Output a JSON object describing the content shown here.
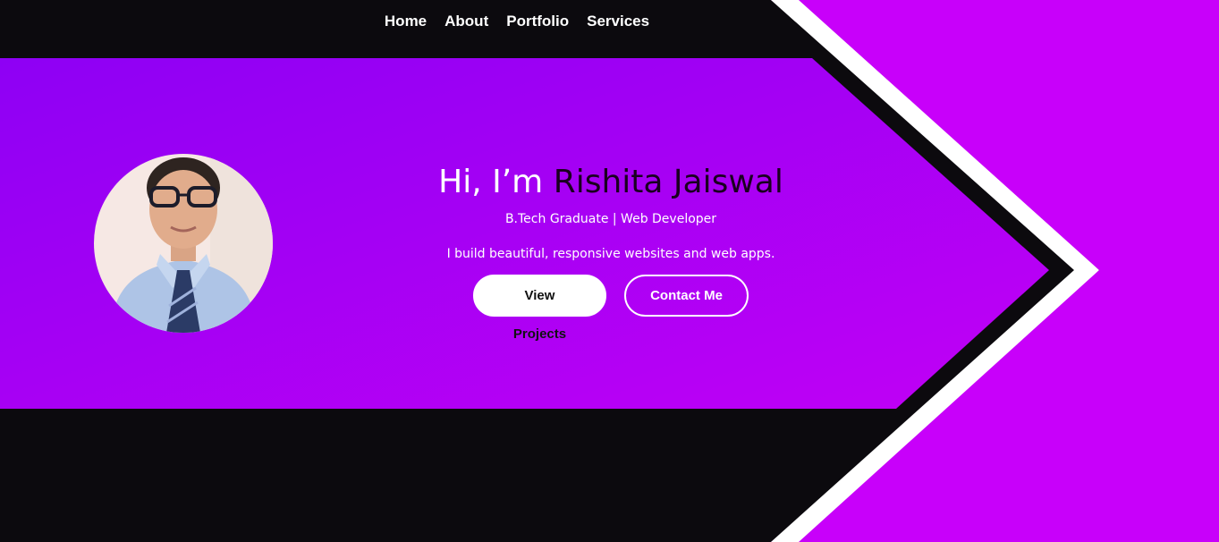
{
  "nav": {
    "items": [
      {
        "label": "Home"
      },
      {
        "label": "About"
      },
      {
        "label": "Portfolio"
      },
      {
        "label": "Services"
      }
    ]
  },
  "hero": {
    "greeting": "Hi, I’m",
    "name": "Rishita Jaiswal",
    "subtitle": "B.Tech Graduate | Web Developer",
    "tagline": "I build beautiful, responsive websites and web apps.",
    "buttons": {
      "primary": "View Projects",
      "secondary": "Contact Me"
    }
  },
  "colors": {
    "background_dark": "#0c0a0e",
    "accent_purple": "#c800fa",
    "hero_gradient_start": "#8e00f4",
    "hero_gradient_end": "#c100f5",
    "text_light": "#ffffff"
  },
  "avatar": {
    "icon": "profile-photo"
  }
}
